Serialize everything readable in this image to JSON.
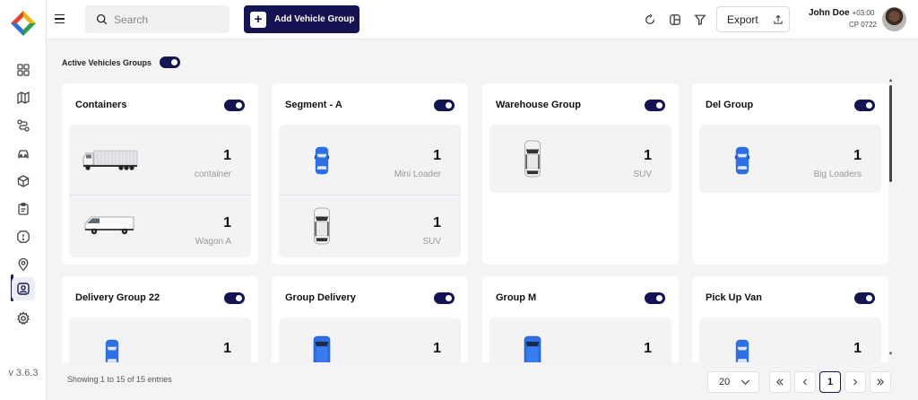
{
  "sidebar": {
    "version": "v 3.6.3",
    "items": [
      {
        "name": "dashboard"
      },
      {
        "name": "map"
      },
      {
        "name": "routes"
      },
      {
        "name": "vehicles"
      },
      {
        "name": "packages"
      },
      {
        "name": "tasks"
      },
      {
        "name": "alerts"
      },
      {
        "name": "locations"
      },
      {
        "name": "users"
      },
      {
        "name": "settings"
      }
    ]
  },
  "header": {
    "search_placeholder": "Search",
    "add_button_label": "Add Vehicle Group",
    "export_label": "Export",
    "user_name": "John Doe",
    "user_tz": "+03:00",
    "user_code": "CP 0722"
  },
  "main": {
    "active_label": "Active Vehicles Groups",
    "active_enabled": true,
    "groups": [
      {
        "title": "Containers",
        "enabled": true,
        "vehicles": [
          {
            "count": "1",
            "type": "container",
            "icon": "container-truck"
          },
          {
            "count": "1",
            "type": "Wagon A",
            "icon": "white-van"
          }
        ]
      },
      {
        "title": "Segment - A",
        "enabled": true,
        "vehicles": [
          {
            "count": "1",
            "type": "Mini Loader",
            "icon": "blue-car-top"
          },
          {
            "count": "1",
            "type": "SUV",
            "icon": "white-suv-top"
          }
        ]
      },
      {
        "title": "Warehouse Group",
        "enabled": true,
        "vehicles": [
          {
            "count": "1",
            "type": "SUV",
            "icon": "white-suv-top"
          }
        ]
      },
      {
        "title": "Del Group",
        "enabled": true,
        "vehicles": [
          {
            "count": "1",
            "type": "Big Loaders",
            "icon": "blue-car-top"
          }
        ]
      },
      {
        "title": "Delivery Group 22",
        "enabled": true,
        "vehicles": [
          {
            "count": "1",
            "type": "",
            "icon": "blue-car-top"
          }
        ]
      },
      {
        "title": "Group Delivery",
        "enabled": true,
        "vehicles": [
          {
            "count": "1",
            "type": "",
            "icon": "blue-van-top"
          }
        ]
      },
      {
        "title": "Group M",
        "enabled": true,
        "vehicles": [
          {
            "count": "1",
            "type": "",
            "icon": "blue-van-top"
          }
        ]
      },
      {
        "title": "Pick Up Van",
        "enabled": true,
        "vehicles": [
          {
            "count": "1",
            "type": "",
            "icon": "blue-car-top"
          }
        ]
      }
    ]
  },
  "footer": {
    "entries_text": "Showing 1 to 15 of 15 entries",
    "page_size": "20",
    "current_page": "1"
  },
  "colors": {
    "primary": "#141452",
    "vehicle_blue": "#2f6fe4",
    "background": "#f4f4f6"
  }
}
